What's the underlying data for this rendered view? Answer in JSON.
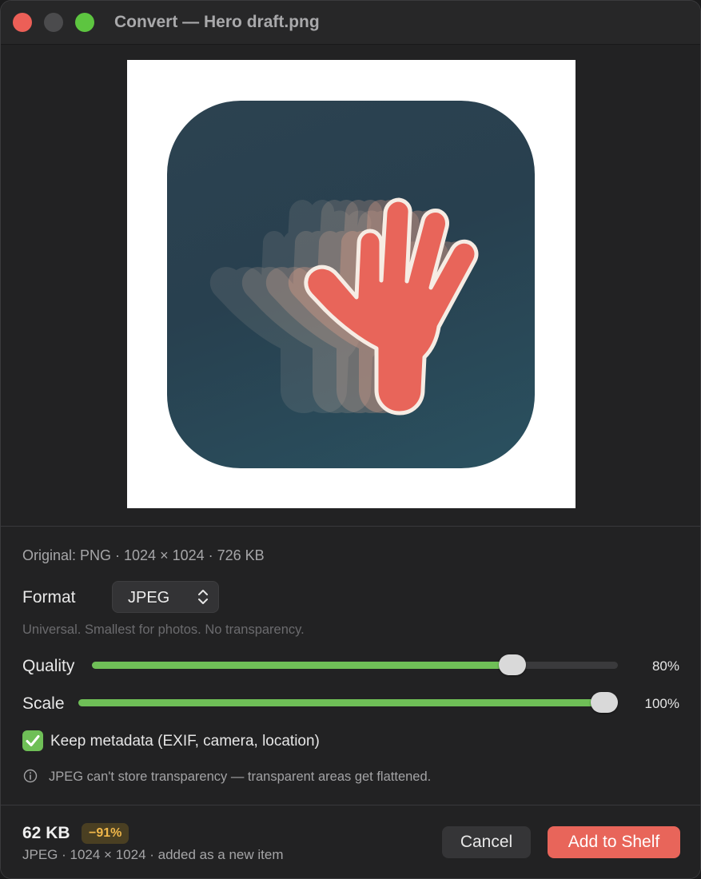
{
  "window": {
    "title": "Convert — Hero draft.png"
  },
  "original_info": "Original: PNG · 1024 × 1024 · 726 KB",
  "format": {
    "label": "Format",
    "selected": "JPEG",
    "hint": "Universal. Smallest for photos. No transparency."
  },
  "quality": {
    "label": "Quality",
    "value": 80,
    "display": "80%"
  },
  "scale": {
    "label": "Scale",
    "value": 100,
    "display": "100%"
  },
  "metadata": {
    "label": "Keep metadata (EXIF, camera, location)",
    "checked": true
  },
  "notice": "JPEG can't store transparency — transparent areas get flattened.",
  "result": {
    "size": "62 KB",
    "change_badge": "−91%",
    "details": "JPEG · 1024 × 1024 · added as a new item"
  },
  "buttons": {
    "cancel": "Cancel",
    "primary": "Add to Shelf"
  },
  "colors": {
    "accent": "#6fbf57",
    "primary_button": "#e8655a",
    "badge_text": "#f0b74a",
    "hand": "#e8655a"
  },
  "icons": [
    "close-light",
    "minimize-light",
    "zoom-light",
    "up-down-chevron-icon",
    "checkmark-icon",
    "info-icon",
    "waving-hand-icon"
  ]
}
